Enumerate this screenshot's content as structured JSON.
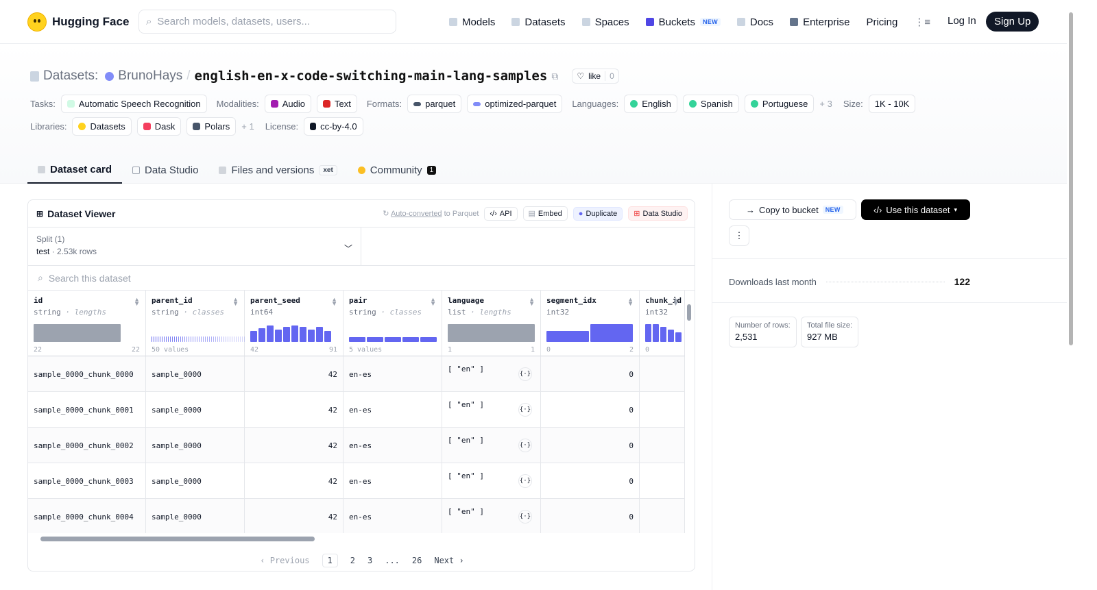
{
  "header": {
    "brand": "Hugging Face",
    "search_placeholder": "Search models, datasets, users...",
    "nav": [
      "Models",
      "Datasets",
      "Spaces",
      "Buckets",
      "Docs",
      "Enterprise",
      "Pricing"
    ],
    "buckets_badge": "NEW",
    "login": "Log In",
    "signup": "Sign Up"
  },
  "repo": {
    "prefix": "Datasets:",
    "owner": "BrunoHays",
    "sep": "/",
    "name": "english-en-x-code-switching-main-lang-samples",
    "like_label": "like",
    "like_count": "0"
  },
  "tags": {
    "tasks_label": "Tasks:",
    "tasks": [
      "Automatic Speech Recognition"
    ],
    "modalities_label": "Modalities:",
    "modalities": [
      "Audio",
      "Text"
    ],
    "formats_label": "Formats:",
    "formats": [
      "parquet",
      "optimized-parquet"
    ],
    "languages_label": "Languages:",
    "languages": [
      "English",
      "Spanish",
      "Portuguese"
    ],
    "languages_more": "+ 3",
    "size_label": "Size:",
    "size": "1K - 10K",
    "libraries_label": "Libraries:",
    "libraries": [
      "Datasets",
      "Dask",
      "Polars"
    ],
    "libraries_more": "+ 1",
    "license_label": "License:",
    "license": "cc-by-4.0"
  },
  "tabs": {
    "card": "Dataset card",
    "studio": "Data Studio",
    "files": "Files and versions",
    "xet": "xet",
    "community": "Community",
    "community_count": "1"
  },
  "viewer": {
    "title": "Dataset Viewer",
    "auto_link": "Auto-converted",
    "auto_rest": "to Parquet",
    "api": "API",
    "embed": "Embed",
    "duplicate": "Duplicate",
    "data_studio": "Data Studio",
    "split_label": "Split (1)",
    "split_name": "test",
    "split_rows": "2.53k rows",
    "search_placeholder": "Search this dataset",
    "columns": [
      {
        "name": "id",
        "type": "string",
        "kind": "lengths",
        "min": "22",
        "max": "22"
      },
      {
        "name": "parent_id",
        "type": "string",
        "kind": "classes",
        "min": "50 values",
        "max": ""
      },
      {
        "name": "parent_seed",
        "type": "int64",
        "kind": "",
        "min": "42",
        "max": "91"
      },
      {
        "name": "pair",
        "type": "string",
        "kind": "classes",
        "min": "5 values",
        "max": ""
      },
      {
        "name": "language",
        "type": "list",
        "kind": "lengths",
        "min": "1",
        "max": "1"
      },
      {
        "name": "segment_idx",
        "type": "int32",
        "kind": "",
        "min": "0",
        "max": "2"
      },
      {
        "name": "chunk_id",
        "type": "int32",
        "kind": "",
        "min": "0",
        "max": ""
      }
    ],
    "rows": [
      {
        "id": "sample_0000_chunk_0000",
        "parent_id": "sample_0000",
        "parent_seed": "42",
        "pair": "en-es",
        "language": "[ \"en\" ]",
        "segment_idx": "0"
      },
      {
        "id": "sample_0000_chunk_0001",
        "parent_id": "sample_0000",
        "parent_seed": "42",
        "pair": "en-es",
        "language": "[ \"en\" ]",
        "segment_idx": "0"
      },
      {
        "id": "sample_0000_chunk_0002",
        "parent_id": "sample_0000",
        "parent_seed": "42",
        "pair": "en-es",
        "language": "[ \"en\" ]",
        "segment_idx": "0"
      },
      {
        "id": "sample_0000_chunk_0003",
        "parent_id": "sample_0000",
        "parent_seed": "42",
        "pair": "en-es",
        "language": "[ \"en\" ]",
        "segment_idx": "0"
      },
      {
        "id": "sample_0000_chunk_0004",
        "parent_id": "sample_0000",
        "parent_seed": "42",
        "pair": "en-es",
        "language": "[ \"en\" ]",
        "segment_idx": "0"
      }
    ],
    "pager": {
      "prev": "Previous",
      "pages": [
        "1",
        "2",
        "3",
        "...",
        "26"
      ],
      "next": "Next"
    }
  },
  "sidebar": {
    "copy": "Copy to bucket",
    "copy_badge": "NEW",
    "use": "Use this dataset",
    "downloads_label": "Downloads last month",
    "downloads": "122",
    "rows_label": "Number of rows:",
    "rows_value": "2,531",
    "size_label": "Total file size:",
    "size_value": "927 MB"
  },
  "colors": {
    "accent": "#6366f1",
    "dark": "#111827",
    "border": "#e5e7eb"
  }
}
